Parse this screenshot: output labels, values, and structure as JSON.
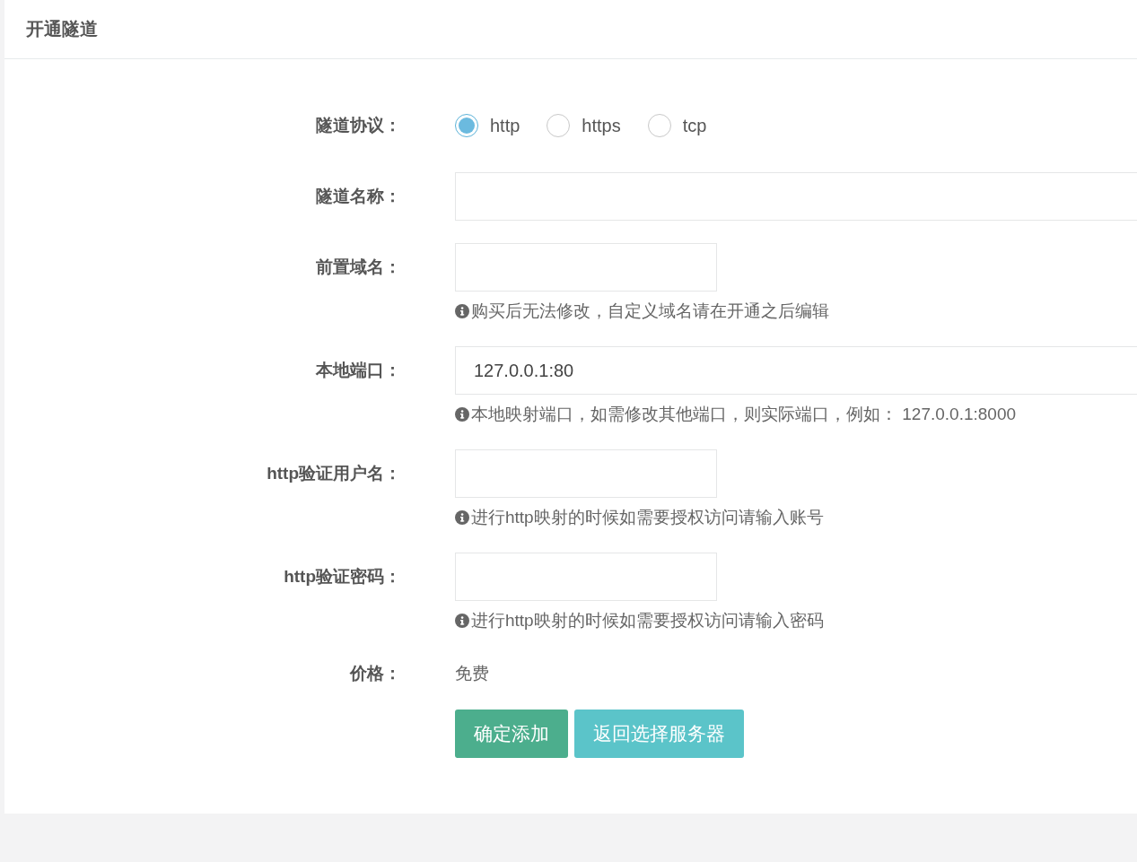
{
  "header": {
    "title": "开通隧道"
  },
  "fields": [
    {
      "kind": "radio",
      "label": "隧道协议：",
      "options": [
        {
          "label": "http",
          "selected": true
        },
        {
          "label": "https",
          "selected": false
        },
        {
          "label": "tcp",
          "selected": false
        }
      ]
    },
    {
      "kind": "widefield",
      "label": "隧道名称："
    },
    {
      "kind": "shortfield",
      "label": "前置域名：",
      "help": "购买后无法修改，自定义域名请在开通之后编辑"
    },
    {
      "kind": "widefield",
      "label": "本地端口：",
      "value": "127.0.0.1:80",
      "help": "本地映射端口，如需修改其他端口，则实际端口，例如： 127.0.0.1:8000"
    },
    {
      "kind": "shortfield",
      "label": "http验证用户名：",
      "help": "进行http映射的时候如需要授权访问请输入账号"
    },
    {
      "kind": "shortfield",
      "label": "http验证密码：",
      "help": "进行http映射的时候如需要授权访问请输入密码"
    },
    {
      "kind": "text",
      "label": "价格：",
      "value": "免费"
    }
  ],
  "buttons": [
    {
      "label": "确定添加",
      "kind": "primary"
    },
    {
      "label": "返回选择服务器",
      "kind": "info"
    }
  ]
}
